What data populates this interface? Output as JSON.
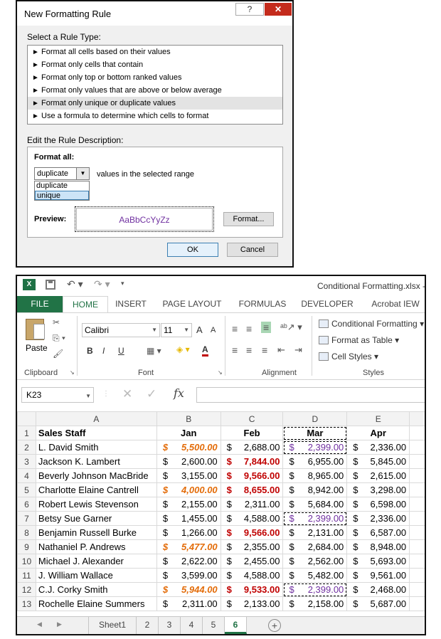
{
  "dialog": {
    "title": "New Formatting Rule",
    "help": "?",
    "close": "✕",
    "select_label": "Select a Rule Type:",
    "rule_types": [
      "Format all cells based on their values",
      "Format only cells that contain",
      "Format only top or bottom ranked values",
      "Format only values that are above or below average",
      "Format only unique or duplicate values",
      "Use a formula to determine which cells to format"
    ],
    "selected_index": 4,
    "edit_label": "Edit the Rule Description:",
    "format_all_label": "Format all:",
    "dropdown_value": "duplicate",
    "dropdown_options": [
      "duplicate",
      "unique"
    ],
    "range_text": "values in the selected range",
    "preview_label": "Preview:",
    "preview_sample": "AaBbCcYyZz",
    "format_button": "Format...",
    "ok_button": "OK",
    "cancel_button": "Cancel"
  },
  "excel": {
    "doc_title": "Conditional Formatting.xlsx -",
    "tabs": [
      "FILE",
      "HOME",
      "INSERT",
      "PAGE LAYOUT",
      "FORMULAS",
      "DEVELOPER",
      "Acrobat IEW"
    ],
    "active_tab": "HOME",
    "ribbon": {
      "paste": "Paste",
      "clipboard": "Clipboard",
      "font_name": "Calibri",
      "font_size": "11",
      "font_group": "Font",
      "alignment_group": "Alignment",
      "styles_group": "Styles",
      "conditional_formatting": "Conditional Formatting",
      "format_as_table": "Format as Table",
      "cell_styles": "Cell Styles",
      "bold": "B",
      "italic": "I",
      "underline": "U",
      "grow_font": "A",
      "shrink_font": "A",
      "font_color": "A"
    },
    "name_box": "K23",
    "fx": "fx",
    "columns": [
      "A",
      "B",
      "C",
      "D",
      "E"
    ],
    "headers": {
      "a": "Sales Staff",
      "b": "Jan",
      "c": "Feb",
      "d": "Mar",
      "e": "Apr"
    },
    "currency": "$",
    "rows": [
      {
        "n": "2",
        "name": "L. David Smith",
        "jan": "5,500.00",
        "feb": "2,688.00",
        "mar": "2,399.00",
        "apr": "2,336.00"
      },
      {
        "n": "3",
        "name": "Jackson K. Lambert",
        "jan": "2,600.00",
        "feb": "7,844.00",
        "mar": "6,955.00",
        "apr": "5,845.00"
      },
      {
        "n": "4",
        "name": "Beverly Johnson MacBride",
        "jan": "3,155.00",
        "feb": "9,566.00",
        "mar": "8,965.00",
        "apr": "2,615.00"
      },
      {
        "n": "5",
        "name": "Charlotte Elaine Cantrell",
        "jan": "4,000.00",
        "feb": "8,655.00",
        "mar": "8,942.00",
        "apr": "3,298.00"
      },
      {
        "n": "6",
        "name": "Robert Lewis Stevenson",
        "jan": "2,155.00",
        "feb": "2,311.00",
        "mar": "5,684.00",
        "apr": "6,598.00"
      },
      {
        "n": "7",
        "name": "Betsy Sue Garner",
        "jan": "1,455.00",
        "feb": "4,588.00",
        "mar": "2,399.00",
        "apr": "2,336.00"
      },
      {
        "n": "8",
        "name": "Benjamin Russell Burke",
        "jan": "1,266.00",
        "feb": "9,566.00",
        "mar": "2,131.00",
        "apr": "6,587.00"
      },
      {
        "n": "9",
        "name": "Nathaniel P. Andrews",
        "jan": "5,477.00",
        "feb": "2,355.00",
        "mar": "2,684.00",
        "apr": "8,948.00"
      },
      {
        "n": "10",
        "name": "Michael J. Alexander",
        "jan": "2,622.00",
        "feb": "2,455.00",
        "mar": "2,562.00",
        "apr": "5,693.00"
      },
      {
        "n": "11",
        "name": "J. William Wallace",
        "jan": "3,599.00",
        "feb": "4,588.00",
        "mar": "5,482.00",
        "apr": "9,561.00"
      },
      {
        "n": "12",
        "name": "C.J. Corky Smith",
        "jan": "5,944.00",
        "feb": "9,533.00",
        "mar": "2,399.00",
        "apr": "2,468.00"
      },
      {
        "n": "13",
        "name": "Rochelle Elaine Summers",
        "jan": "2,311.00",
        "feb": "2,133.00",
        "mar": "2,158.00",
        "apr": "5,687.00"
      }
    ],
    "header_row_num": "1",
    "sheet_tabs": [
      "Sheet1",
      "2",
      "3",
      "4",
      "5",
      "6"
    ],
    "active_sheet": "6",
    "add_sheet": "+",
    "colors": {
      "excel_green": "#217346",
      "orange": "#e36c09",
      "red": "#c00000",
      "purple": "#7030a0"
    }
  }
}
